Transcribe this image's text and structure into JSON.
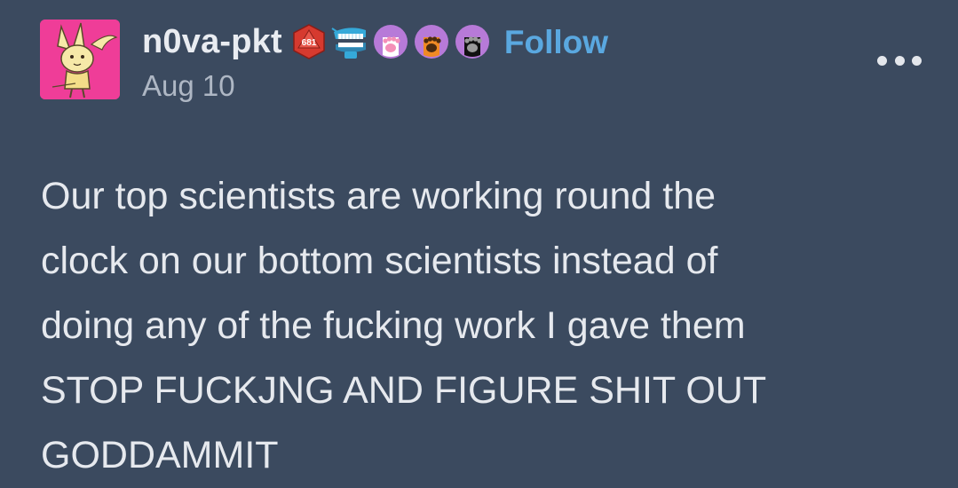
{
  "post": {
    "username": "n0va-pkt",
    "follow_label": "Follow",
    "date": "Aug 10",
    "badges": [
      {
        "icon": "red-d20-dice-icon",
        "text": "681"
      },
      {
        "icon": "chattering-teeth-icon"
      },
      {
        "icon": "pink-paw-icon"
      },
      {
        "icon": "orange-paw-icon"
      },
      {
        "icon": "black-paw-icon"
      }
    ],
    "more_icon": "more-options-icon",
    "body_lines": [
      "Our top scientists are working round the",
      "clock on our bottom scientists instead of",
      "doing any of the fucking work I gave them",
      "STOP FUCKJNG AND FIGURE SHIT OUT",
      "GODDAMMIT"
    ]
  },
  "colors": {
    "background": "#3b4a5f",
    "text": "#e6e9ee",
    "follow": "#5aa8e0",
    "date": "#aeb7c4",
    "avatar_bg": "#ef3d98"
  }
}
